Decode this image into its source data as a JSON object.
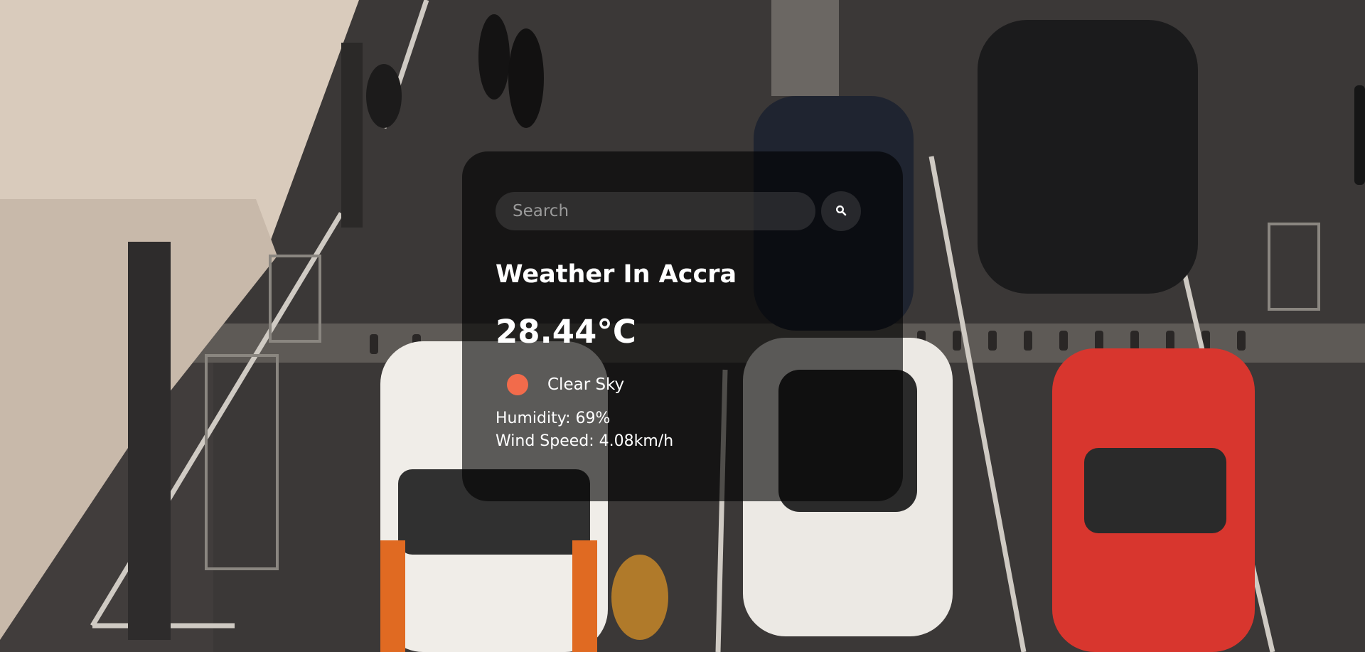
{
  "search": {
    "placeholder": "Search",
    "value": ""
  },
  "weather": {
    "city_title": "Weather In Accra",
    "temperature": "28.44°C",
    "description": "Clear Sky",
    "humidity": "Humidity: 69%",
    "wind_speed": "Wind Speed: 4.08km/h"
  },
  "icons": {
    "search": "search-icon",
    "weather": "clear-sky-icon"
  },
  "colors": {
    "card_bg": "#000000",
    "text": "#ffffff",
    "weather_icon": "#f26b4b"
  }
}
